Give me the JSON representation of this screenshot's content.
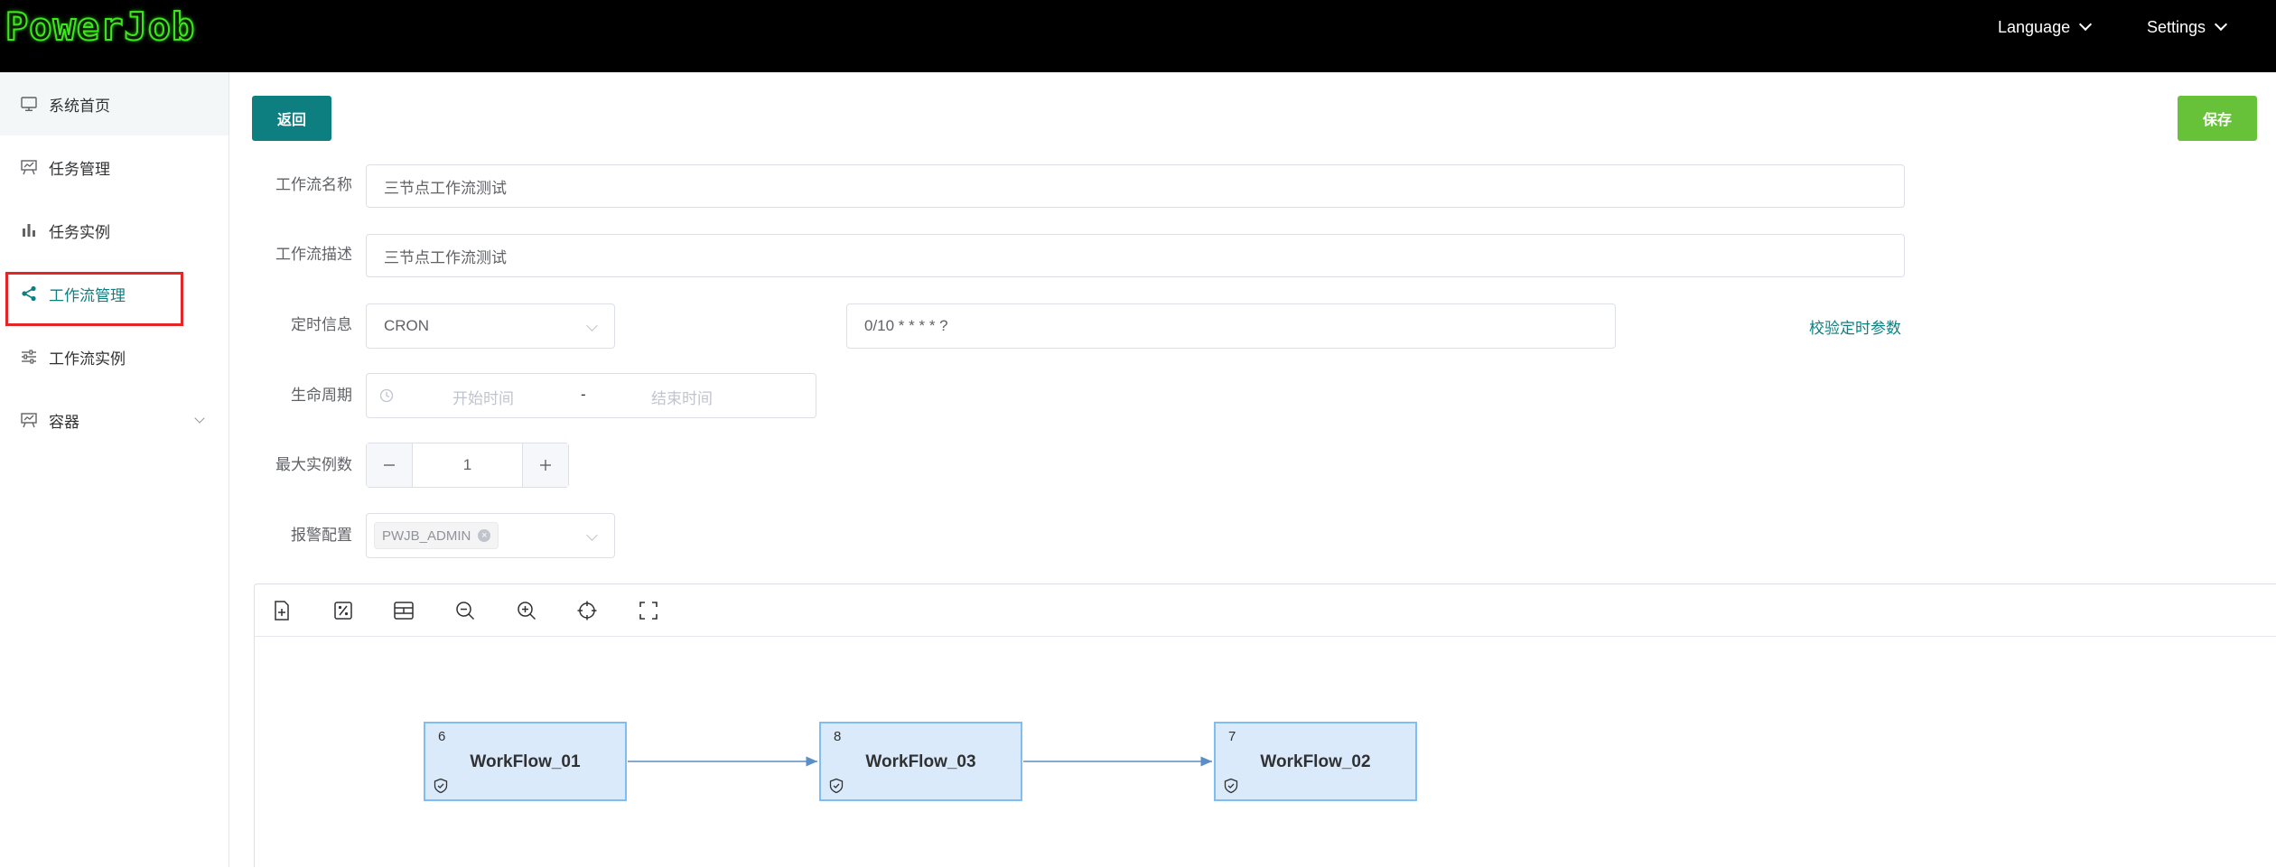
{
  "header": {
    "logo_text": "PowerJob",
    "language_label": "Language",
    "settings_label": "Settings"
  },
  "sidebar": {
    "items": [
      {
        "label": "系统首页",
        "icon": "monitor-icon"
      },
      {
        "label": "任务管理",
        "icon": "presentation-icon"
      },
      {
        "label": "任务实例",
        "icon": "bar-chart-icon"
      },
      {
        "label": "工作流管理",
        "icon": "share-icon",
        "active": true
      },
      {
        "label": "工作流实例",
        "icon": "sliders-icon"
      },
      {
        "label": "容器",
        "icon": "presentation-icon",
        "expandable": true
      }
    ]
  },
  "toolbar": {
    "back_label": "返回",
    "save_label": "保存"
  },
  "form": {
    "name_label": "工作流名称",
    "name_value": "三节点工作流测试",
    "desc_label": "工作流描述",
    "desc_value": "三节点工作流测试",
    "schedule_label": "定时信息",
    "schedule_type": "CRON",
    "schedule_expr": "0/10 * * * * ?",
    "validate_link": "校验定时参数",
    "lifecycle_label": "生命周期",
    "start_placeholder": "开始时间",
    "range_separator": "-",
    "end_placeholder": "结束时间",
    "max_instances_label": "最大实例数",
    "max_instances_value": "1",
    "alarm_label": "报警配置",
    "alarm_tag": "PWJB_ADMIN"
  },
  "canvas": {
    "tools": [
      "add-node-icon",
      "percent-icon",
      "layout-icon",
      "zoom-out-icon",
      "zoom-in-icon",
      "crosshair-icon",
      "fullscreen-icon"
    ],
    "nodes": [
      {
        "id": "6",
        "name": "WorkFlow_01"
      },
      {
        "id": "8",
        "name": "WorkFlow_03"
      },
      {
        "id": "7",
        "name": "WorkFlow_02"
      }
    ]
  },
  "colors": {
    "primary": "#0e7f80",
    "success": "#67c23a",
    "highlight_box": "#e32626",
    "node_fill": "#dbeafb",
    "node_border": "#7fbef2",
    "edge": "#5b8ec4"
  }
}
